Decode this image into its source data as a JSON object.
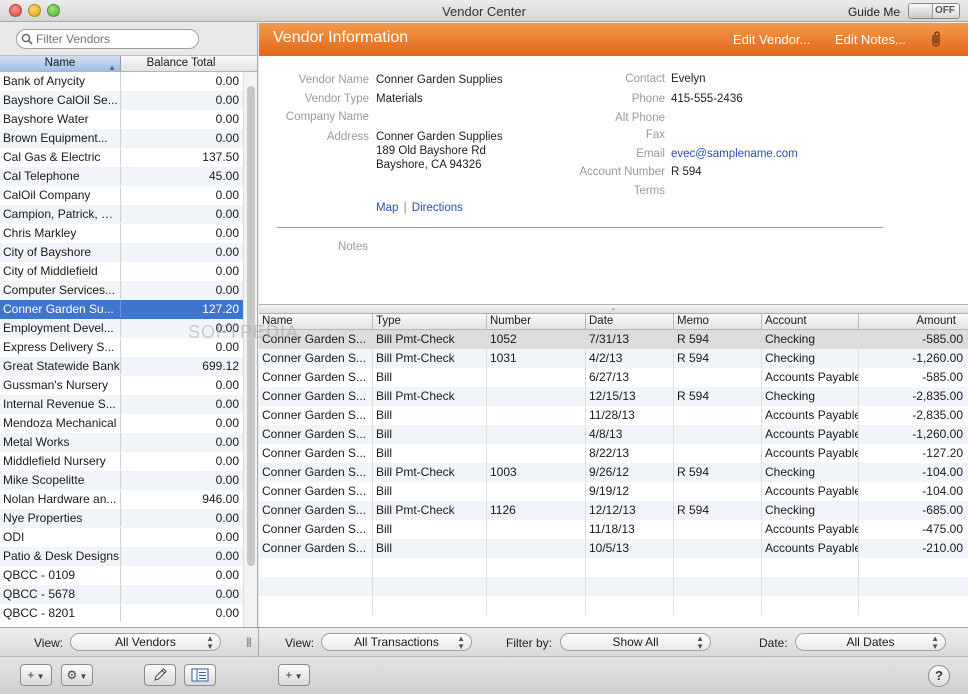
{
  "window": {
    "title": "Vendor Center",
    "guide_label": "Guide Me",
    "guide_toggle": "OFF"
  },
  "search": {
    "placeholder": "Filter Vendors"
  },
  "vendor_list": {
    "headers": [
      "Name",
      "Balance Total"
    ],
    "rows": [
      {
        "name": "Bank of Anycity",
        "balance": "0.00"
      },
      {
        "name": "Bayshore CalOil Se...",
        "balance": "0.00"
      },
      {
        "name": "Bayshore Water",
        "balance": "0.00"
      },
      {
        "name": "Brown Equipment...",
        "balance": "0.00"
      },
      {
        "name": "Cal Gas & Electric",
        "balance": "137.50"
      },
      {
        "name": "Cal Telephone",
        "balance": "45.00"
      },
      {
        "name": "CalOil Company",
        "balance": "0.00"
      },
      {
        "name": "Campion, Patrick, CPA",
        "balance": "0.00"
      },
      {
        "name": "Chris Markley",
        "balance": "0.00"
      },
      {
        "name": "City of Bayshore",
        "balance": "0.00"
      },
      {
        "name": "City of Middlefield",
        "balance": "0.00"
      },
      {
        "name": "Computer Services...",
        "balance": "0.00"
      },
      {
        "name": "Conner Garden Su...",
        "balance": "127.20"
      },
      {
        "name": "Employment Devel...",
        "balance": "0.00"
      },
      {
        "name": "Express Delivery S...",
        "balance": "0.00"
      },
      {
        "name": "Great Statewide Bank",
        "balance": "699.12"
      },
      {
        "name": "Gussman's Nursery",
        "balance": "0.00"
      },
      {
        "name": "Internal Revenue S...",
        "balance": "0.00"
      },
      {
        "name": "Mendoza Mechanical",
        "balance": "0.00"
      },
      {
        "name": "Metal Works",
        "balance": "0.00"
      },
      {
        "name": "Middlefield Nursery",
        "balance": "0.00"
      },
      {
        "name": "Mike Scopelitte",
        "balance": "0.00"
      },
      {
        "name": "Nolan Hardware an...",
        "balance": "946.00"
      },
      {
        "name": "Nye Properties",
        "balance": "0.00"
      },
      {
        "name": "ODI",
        "balance": "0.00"
      },
      {
        "name": "Patio & Desk Designs",
        "balance": "0.00"
      },
      {
        "name": "QBCC - 0109",
        "balance": "0.00"
      },
      {
        "name": "QBCC - 5678",
        "balance": "0.00"
      },
      {
        "name": "QBCC - 8201",
        "balance": "0.00"
      }
    ],
    "selected_index": 12
  },
  "vendor_info": {
    "header": "Vendor Information",
    "edit_vendor": "Edit Vendor...",
    "edit_notes": "Edit Notes...",
    "labels": {
      "vendor_name": "Vendor Name",
      "vendor_type": "Vendor Type",
      "company_name": "Company Name",
      "address": "Address",
      "notes": "Notes",
      "contact": "Contact",
      "phone": "Phone",
      "alt_phone": "Alt Phone",
      "fax": "Fax",
      "email": "Email",
      "account_number": "Account Number",
      "terms": "Terms"
    },
    "vendor_name": "Conner Garden Supplies",
    "vendor_type": "Materials",
    "address_line1": "Conner Garden Supplies",
    "address_line2": "189 Old Bayshore Rd",
    "address_line3": "Bayshore, CA 94326",
    "map_link": "Map",
    "link_sep": "|",
    "directions_link": "Directions",
    "contact": "Evelyn",
    "phone": "415-555-2436",
    "email": "evec@samplename.com",
    "account_number": "R 594"
  },
  "transactions": {
    "headers": [
      "Name",
      "Type",
      "Number",
      "Date",
      "Memo",
      "Account",
      "Amount"
    ],
    "rows": [
      [
        "Conner Garden S...",
        "Bill Pmt-Check",
        "1052",
        "7/31/13",
        "R 594",
        "Checking",
        "-585.00"
      ],
      [
        "Conner Garden S...",
        "Bill Pmt-Check",
        "1031",
        "4/2/13",
        "R 594",
        "Checking",
        "-1,260.00"
      ],
      [
        "Conner Garden S...",
        "Bill",
        "",
        "6/27/13",
        "",
        "Accounts Payable",
        "-585.00"
      ],
      [
        "Conner Garden S...",
        "Bill Pmt-Check",
        "",
        "12/15/13",
        "R 594",
        "Checking",
        "-2,835.00"
      ],
      [
        "Conner Garden S...",
        "Bill",
        "",
        "11/28/13",
        "",
        "Accounts Payable",
        "-2,835.00"
      ],
      [
        "Conner Garden S...",
        "Bill",
        "",
        "4/8/13",
        "",
        "Accounts Payable",
        "-1,260.00"
      ],
      [
        "Conner Garden S...",
        "Bill",
        "",
        "8/22/13",
        "",
        "Accounts Payable",
        "-127.20"
      ],
      [
        "Conner Garden S...",
        "Bill Pmt-Check",
        "1003",
        "9/26/12",
        "R 594",
        "Checking",
        "-104.00"
      ],
      [
        "Conner Garden S...",
        "Bill",
        "",
        "9/19/12",
        "",
        "Accounts Payable",
        "-104.00"
      ],
      [
        "Conner Garden S...",
        "Bill Pmt-Check",
        "1126",
        "12/12/13",
        "R 594",
        "Checking",
        "-685.00"
      ],
      [
        "Conner Garden S...",
        "Bill",
        "",
        "11/18/13",
        "",
        "Accounts Payable",
        "-475.00"
      ],
      [
        "Conner Garden S...",
        "Bill",
        "",
        "10/5/13",
        "",
        "Accounts Payable",
        "-210.00"
      ]
    ],
    "highlighted_index": 0
  },
  "footer": {
    "view_label": "View:",
    "vendors_view": "All Vendors",
    "tx_view_label": "View:",
    "tx_view": "All Transactions",
    "filter_label": "Filter by:",
    "filter_value": "Show All",
    "date_label": "Date:",
    "date_value": "All Dates"
  },
  "bottom": {
    "add_glyph": "+",
    "gear_glyph": "⚙",
    "help_glyph": "?"
  },
  "watermark": "SOFTPEDIA",
  "colors": {
    "accent_orange": "#e8732b",
    "selection_blue": "#3f74cf",
    "link": "#2c4bb3"
  }
}
